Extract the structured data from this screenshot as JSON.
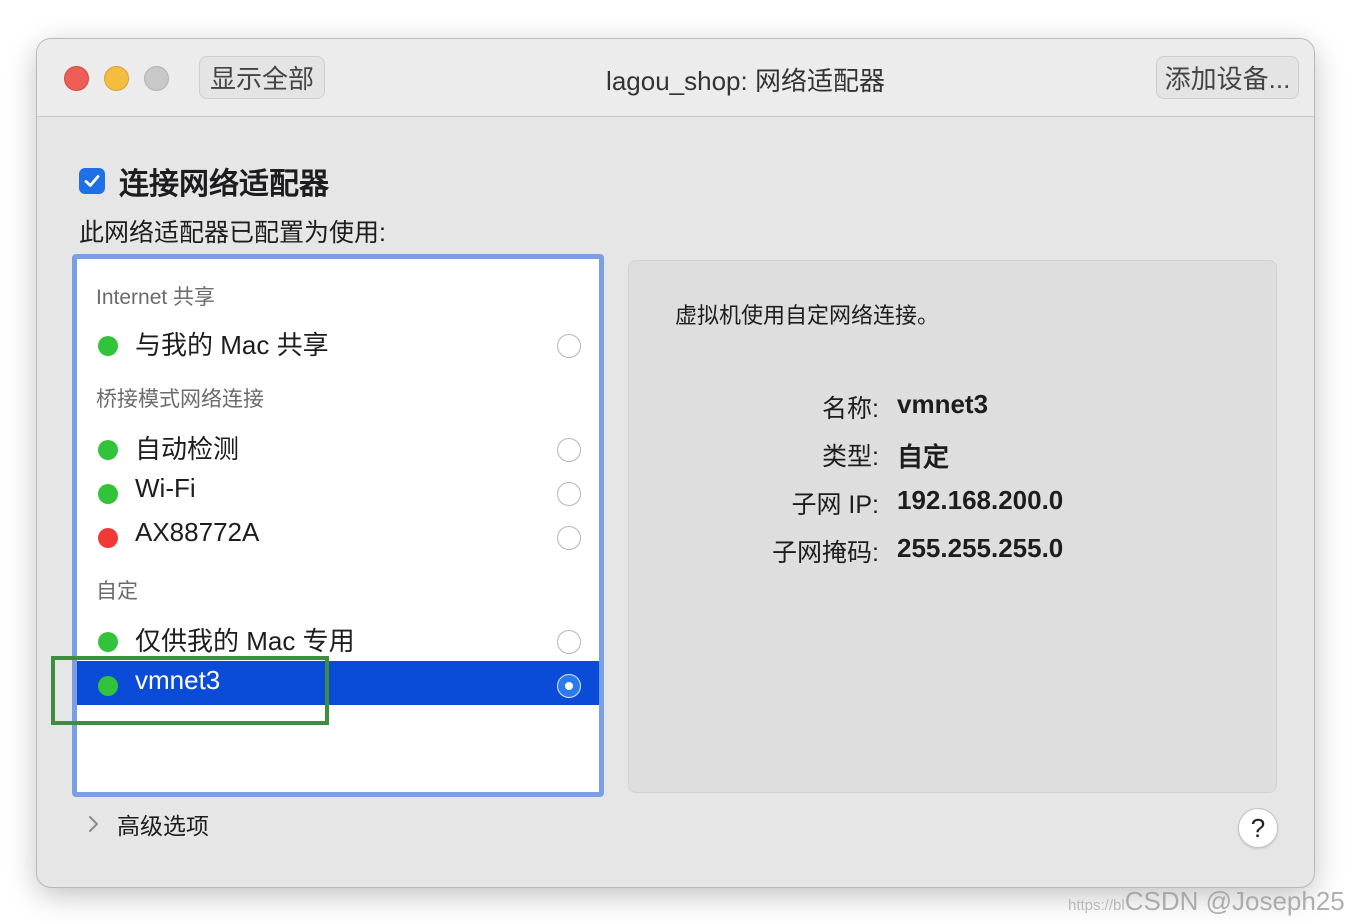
{
  "window": {
    "title": "lagou_shop: 网络适配器",
    "show_all_label": "显示全部",
    "add_device_label": "添加设备..."
  },
  "connect": {
    "label": "连接网络适配器",
    "checked": true
  },
  "config_label": "此网络适配器已配置为使用:",
  "sections": {
    "internet": "Internet 共享",
    "bridged": "桥接模式网络连接",
    "custom": "自定"
  },
  "items": {
    "share_mac": {
      "label": "与我的 Mac 共享",
      "status": "green"
    },
    "auto_detect": {
      "label": "自动检测",
      "status": "green"
    },
    "wifi": {
      "label": "Wi-Fi",
      "status": "green"
    },
    "ax88772a": {
      "label": "AX88772A",
      "status": "red"
    },
    "mac_only": {
      "label": "仅供我的 Mac 专用",
      "status": "green"
    },
    "vmnet3": {
      "label": "vmnet3",
      "status": "green",
      "selected": true
    }
  },
  "detail": {
    "description": "虚拟机使用自定网络连接。",
    "name_key": "名称:",
    "name_value": "vmnet3",
    "type_key": "类型:",
    "type_value": "自定",
    "subnet_key": "子网 IP:",
    "subnet_value": "192.168.200.0",
    "mask_key": "子网掩码:",
    "mask_value": "255.255.255.0"
  },
  "advanced_label": "高级选项",
  "help_label": "?",
  "watermark": {
    "prefix": "https://bl",
    "text": "CSDN @Joseph25"
  },
  "colors": {
    "accent": "#0a4bd8",
    "checkbox": "#1f6fe6",
    "status_green": "#33c33a",
    "status_red": "#f03a36",
    "annotation_green": "#3e8e41"
  }
}
